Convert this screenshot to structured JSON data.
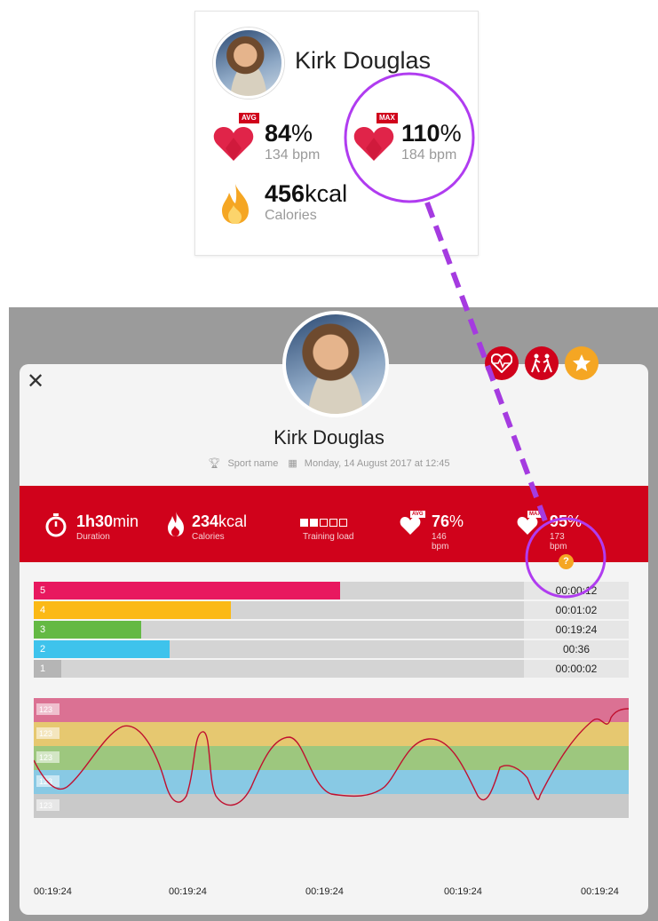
{
  "summary_card": {
    "name": "Kirk Douglas",
    "avg": {
      "badge": "AVG",
      "value": "84",
      "unit": "%",
      "bpm": "134 bpm"
    },
    "max": {
      "badge": "MAX",
      "value": "110",
      "unit": "%",
      "bpm": "184 bpm"
    },
    "calories": {
      "value": "456",
      "unit": "kcal",
      "label": "Calories"
    }
  },
  "dialog": {
    "close_label": "✕",
    "name": "Kirk Douglas",
    "sport": "Sport name",
    "date": "Monday, 14 August 2017 at 12:45",
    "stats": {
      "duration": {
        "value": "1h30",
        "unit": "min",
        "label": "Duration"
      },
      "calories": {
        "value": "234",
        "unit": "kcal",
        "label": "Calories"
      },
      "training_load": {
        "label": "Training load",
        "level": 2,
        "max": 5
      },
      "avg": {
        "badge": "AVG",
        "value": "76",
        "unit": "%",
        "bpm": "146 bpm"
      },
      "max": {
        "badge": "MAX",
        "value": "95",
        "unit": "%",
        "bpm": "173 bpm"
      },
      "help": "?"
    },
    "zones": [
      {
        "zone": "5",
        "time": "00:00:12",
        "fraction": 0.61,
        "color": "#e8185f"
      },
      {
        "zone": "4",
        "time": "00:01:02",
        "fraction": 0.38,
        "color": "#fbb916"
      },
      {
        "zone": "3",
        "time": "00:19:24",
        "fraction": 0.19,
        "color": "#64b944"
      },
      {
        "zone": "2",
        "time": "00:36",
        "fraction": 0.25,
        "color": "#3ec3ec"
      },
      {
        "zone": "1",
        "time": "00:00:02",
        "fraction": 0.02,
        "color": "#b5b5b5"
      }
    ],
    "chart": {
      "band_labels": [
        "123",
        "123",
        "123",
        "123",
        "123"
      ],
      "band_colors": [
        "#db7193",
        "#e6c870",
        "#9dc77e",
        "#88c9e4",
        "#c9c9c9"
      ],
      "line_color": "#c0102f",
      "x_labels": [
        "00:19:24",
        "00:19:24",
        "00:19:24",
        "00:19:24",
        "00:19:24"
      ]
    }
  },
  "colors": {
    "red": "#d0021b",
    "purple": "#a020f0",
    "gold": "#f5a623"
  }
}
